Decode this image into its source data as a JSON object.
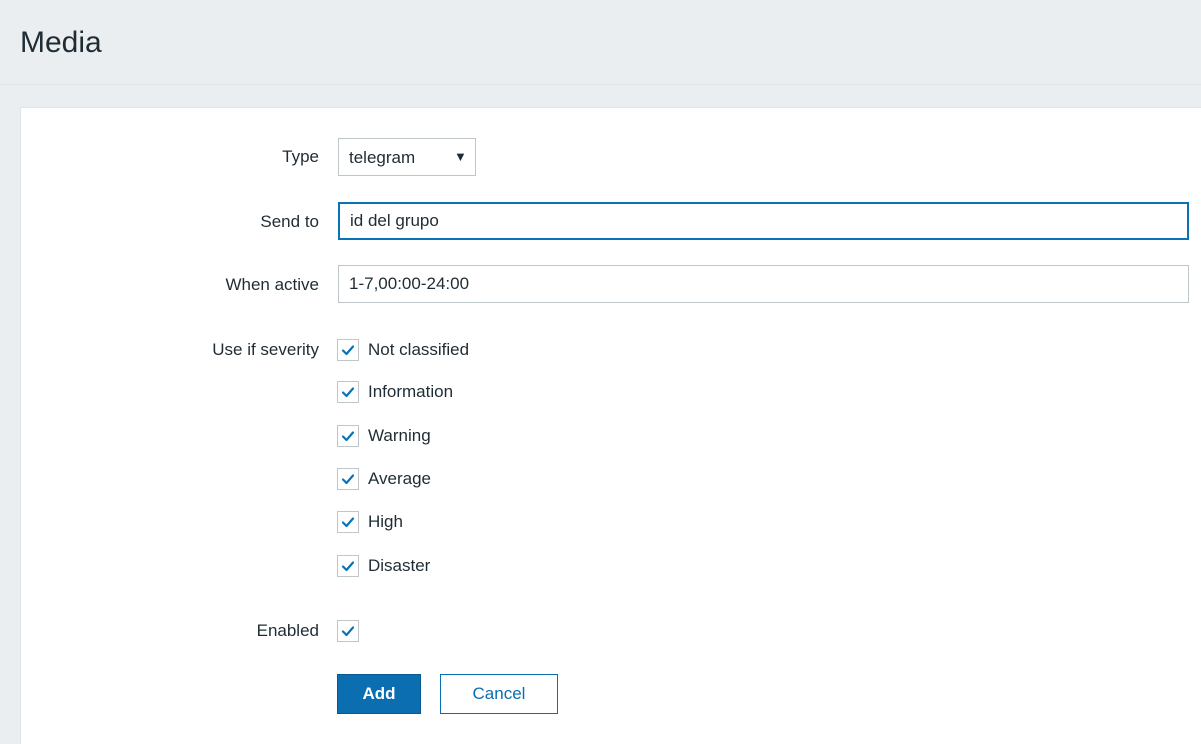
{
  "header": {
    "title": "Media"
  },
  "form": {
    "type": {
      "label": "Type",
      "value": "telegram",
      "arrow": "▼"
    },
    "send_to": {
      "label": "Send to",
      "value": "id del grupo"
    },
    "when_active": {
      "label": "When active",
      "value": "1-7,00:00-24:00"
    },
    "severity": {
      "label": "Use if severity",
      "options": [
        {
          "label": "Not classified",
          "checked": true
        },
        {
          "label": "Information",
          "checked": true
        },
        {
          "label": "Warning",
          "checked": true
        },
        {
          "label": "Average",
          "checked": true
        },
        {
          "label": "High",
          "checked": true
        },
        {
          "label": "Disaster",
          "checked": true
        }
      ]
    },
    "enabled": {
      "label": "Enabled",
      "checked": true
    }
  },
  "buttons": {
    "add": "Add",
    "cancel": "Cancel"
  },
  "colors": {
    "accent": "#0a6eb0",
    "check": "#0a73b8",
    "background": "#ebeef0"
  },
  "icons": {
    "checkmark": "checkmark-icon",
    "dropdown": "caret-down-icon"
  }
}
